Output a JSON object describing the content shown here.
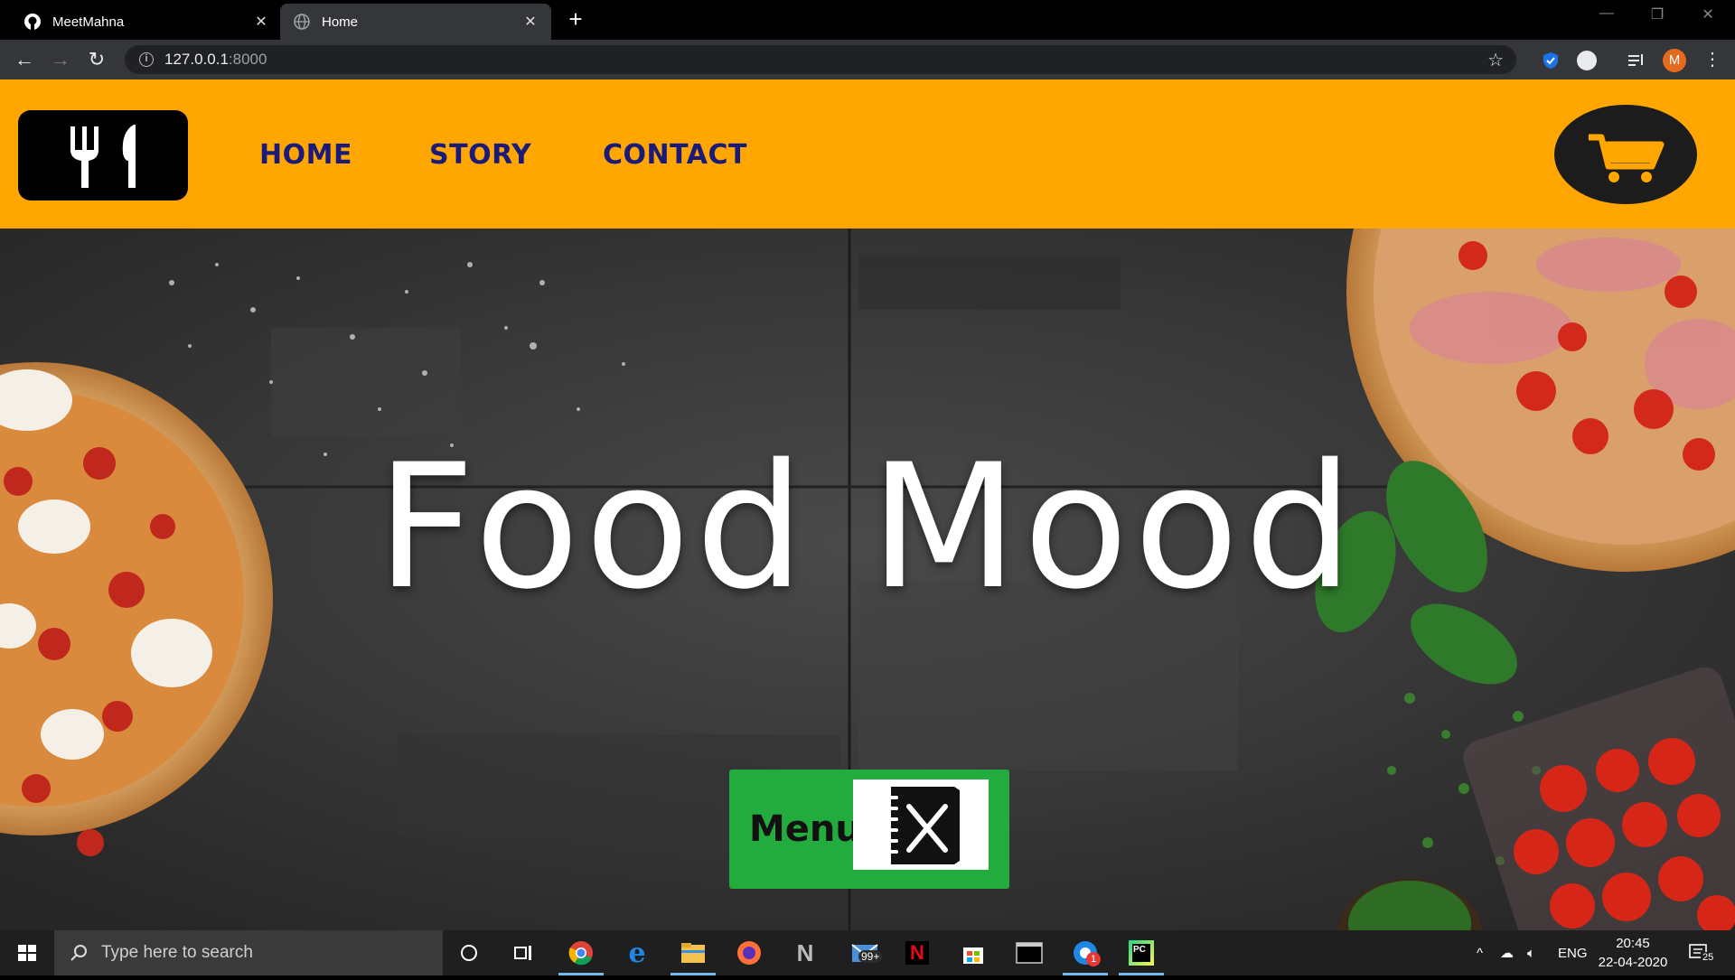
{
  "browser": {
    "tabs": [
      {
        "title": "MeetMahna",
        "active": false
      },
      {
        "title": "Home",
        "active": true
      }
    ],
    "address": {
      "host": "127.0.0.1",
      "port": ":8000"
    },
    "profile_initial": "M",
    "window_controls": [
      "minimize",
      "restore",
      "close"
    ]
  },
  "site": {
    "brand_color": "#ffa600",
    "nav": [
      {
        "label": "HOME"
      },
      {
        "label": "STORY"
      },
      {
        "label": "CONTACT"
      }
    ],
    "hero": {
      "title": "Food Mood",
      "menu_button_label": "Menu",
      "button_color": "#22ac3d"
    }
  },
  "taskbar": {
    "search_placeholder": "Type here to search",
    "mail_badge": "99+",
    "chrome_badge": "1",
    "language": "ENG",
    "time": "20:45",
    "date": "22-04-2020",
    "notification_count": "25",
    "pinned_apps": [
      "cortana",
      "task-view",
      "chrome",
      "edge",
      "file-explorer",
      "firefox",
      "notion",
      "mail",
      "netflix",
      "store",
      "terminal",
      "chrome-profile",
      "pycharm"
    ]
  }
}
